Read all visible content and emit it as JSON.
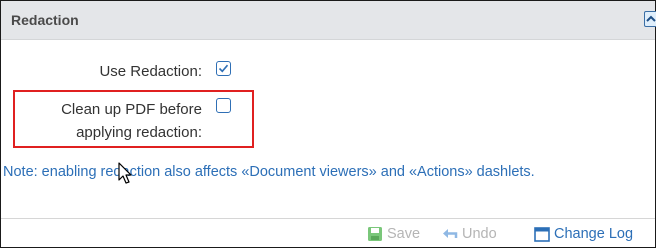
{
  "panel": {
    "title": "Redaction"
  },
  "settings": {
    "use_redaction_label": "Use Redaction:",
    "use_redaction_checked": true,
    "cleanup_label_line1": "Clean up PDF before",
    "cleanup_label_line2": "applying redaction:",
    "cleanup_checked": false
  },
  "note": {
    "text": "Note: enabling redaction also affects «Document viewers» and «Actions» dashlets."
  },
  "footer": {
    "save_label": "Save",
    "undo_label": "Undo",
    "changelog_label": "Change Log"
  },
  "icons": {
    "collapse": "chevron-up-icon",
    "save": "floppy-disk-icon",
    "undo": "undo-arrow-icon",
    "changelog": "calendar-icon",
    "cursor": "mouse-pointer-icon"
  },
  "colors": {
    "accent": "#2c6fb7",
    "highlight_border": "#e02020",
    "disabled_text": "#b5b5b5",
    "save_icon": "#7ac77a",
    "header_bg": "#e4e6e9"
  }
}
